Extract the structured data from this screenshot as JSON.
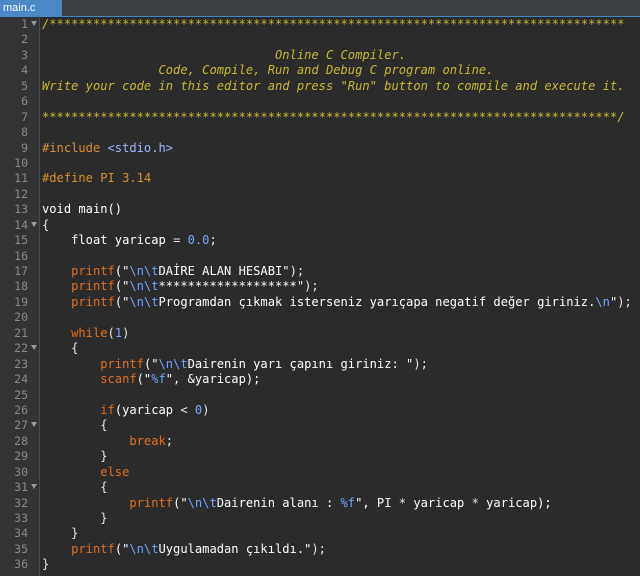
{
  "tab": {
    "label": "main.c"
  },
  "lines": [
    {
      "n": "1",
      "fold": true,
      "t": [
        [
          "/*******************************************************************************",
          "com"
        ]
      ]
    },
    {
      "n": "2",
      "fold": false,
      "t": []
    },
    {
      "n": "3",
      "fold": false,
      "t": [
        [
          "                                Online C Compiler.",
          "com"
        ]
      ]
    },
    {
      "n": "4",
      "fold": false,
      "t": [
        [
          "                Code, Compile, Run and Debug C program online.",
          "com"
        ]
      ]
    },
    {
      "n": "5",
      "fold": false,
      "t": [
        [
          "Write your code in this editor and press \"Run\" button to compile and execute it.",
          "com"
        ]
      ]
    },
    {
      "n": "6",
      "fold": false,
      "t": []
    },
    {
      "n": "7",
      "fold": false,
      "t": [
        [
          "*******************************************************************************/",
          "com"
        ]
      ]
    },
    {
      "n": "8",
      "fold": false,
      "t": []
    },
    {
      "n": "9",
      "fold": false,
      "t": [
        [
          "#include ",
          "pp"
        ],
        [
          "<stdio.h>",
          "inc"
        ]
      ]
    },
    {
      "n": "10",
      "fold": false,
      "t": []
    },
    {
      "n": "11",
      "fold": false,
      "t": [
        [
          "#define PI 3.14",
          "pp"
        ]
      ]
    },
    {
      "n": "12",
      "fold": false,
      "t": []
    },
    {
      "n": "13",
      "fold": false,
      "t": [
        [
          "void main()",
          "kw"
        ]
      ]
    },
    {
      "n": "14",
      "fold": true,
      "t": [
        [
          "{",
          "op"
        ]
      ]
    },
    {
      "n": "15",
      "fold": false,
      "t": [
        [
          "    float yaricap ",
          "kw"
        ],
        [
          "= ",
          "op"
        ],
        [
          "0.0",
          "num"
        ],
        [
          ";",
          "op"
        ]
      ]
    },
    {
      "n": "16",
      "fold": false,
      "t": []
    },
    {
      "n": "17",
      "fold": false,
      "t": [
        [
          "    printf",
          "fn"
        ],
        [
          "(\"",
          "str"
        ],
        [
          "\\n\\t",
          "esc"
        ],
        [
          "DAİRE ALAN HESABI\"",
          "str"
        ],
        [
          ");",
          "op"
        ]
      ]
    },
    {
      "n": "18",
      "fold": false,
      "t": [
        [
          "    printf",
          "fn"
        ],
        [
          "(\"",
          "str"
        ],
        [
          "\\n\\t",
          "esc"
        ],
        [
          "*******************\"",
          "str"
        ],
        [
          ");",
          "op"
        ]
      ]
    },
    {
      "n": "19",
      "fold": false,
      "t": [
        [
          "    printf",
          "fn"
        ],
        [
          "(\"",
          "str"
        ],
        [
          "\\n\\t",
          "esc"
        ],
        [
          "Programdan çıkmak isterseniz yarıçapa negatif değer giriniz.",
          "str"
        ],
        [
          "\\n",
          "esc"
        ],
        [
          "\"",
          "str"
        ],
        [
          ");",
          "op"
        ]
      ]
    },
    {
      "n": "20",
      "fold": false,
      "t": []
    },
    {
      "n": "21",
      "fold": false,
      "t": [
        [
          "    while",
          "fn"
        ],
        [
          "(",
          "op"
        ],
        [
          "1",
          "num"
        ],
        [
          ")",
          "op"
        ]
      ]
    },
    {
      "n": "22",
      "fold": true,
      "t": [
        [
          "    {",
          "op"
        ]
      ]
    },
    {
      "n": "23",
      "fold": false,
      "t": [
        [
          "        printf",
          "fn"
        ],
        [
          "(\"",
          "str"
        ],
        [
          "\\n\\t",
          "esc"
        ],
        [
          "Dairenin yarı çapını giriniz: \"",
          "str"
        ],
        [
          ");",
          "op"
        ]
      ]
    },
    {
      "n": "24",
      "fold": false,
      "t": [
        [
          "        scanf",
          "fn"
        ],
        [
          "(\"",
          "str"
        ],
        [
          "%f",
          "esc"
        ],
        [
          "\", &yaricap);",
          "str"
        ]
      ]
    },
    {
      "n": "25",
      "fold": false,
      "t": []
    },
    {
      "n": "26",
      "fold": false,
      "t": [
        [
          "        if",
          "fn"
        ],
        [
          "(yaricap ",
          "kw"
        ],
        [
          "< ",
          "op"
        ],
        [
          "0",
          "num"
        ],
        [
          ")",
          "op"
        ]
      ]
    },
    {
      "n": "27",
      "fold": true,
      "t": [
        [
          "        {",
          "op"
        ]
      ]
    },
    {
      "n": "28",
      "fold": false,
      "t": [
        [
          "            break",
          "brk"
        ],
        [
          ";",
          "op"
        ]
      ]
    },
    {
      "n": "29",
      "fold": false,
      "t": [
        [
          "        }",
          "op"
        ]
      ]
    },
    {
      "n": "30",
      "fold": false,
      "t": [
        [
          "        else",
          "brk"
        ]
      ]
    },
    {
      "n": "31",
      "fold": true,
      "t": [
        [
          "        {",
          "op"
        ]
      ]
    },
    {
      "n": "32",
      "fold": false,
      "t": [
        [
          "            printf",
          "fn"
        ],
        [
          "(\"",
          "str"
        ],
        [
          "\\n\\t",
          "esc"
        ],
        [
          "Dairenin alanı : ",
          "str"
        ],
        [
          "%f",
          "esc"
        ],
        [
          "\", PI ",
          "str"
        ],
        [
          "* ",
          "op"
        ],
        [
          "yaricap ",
          "kw"
        ],
        [
          "* ",
          "op"
        ],
        [
          "yaricap);",
          "kw"
        ]
      ]
    },
    {
      "n": "33",
      "fold": false,
      "t": [
        [
          "        }",
          "op"
        ]
      ]
    },
    {
      "n": "34",
      "fold": false,
      "t": [
        [
          "    }",
          "op"
        ]
      ]
    },
    {
      "n": "35",
      "fold": false,
      "t": [
        [
          "    printf",
          "fn"
        ],
        [
          "(\"",
          "str"
        ],
        [
          "\\n\\t",
          "esc"
        ],
        [
          "Uygulamadan çıkıldı.\"",
          "str"
        ],
        [
          ");",
          "op"
        ]
      ]
    },
    {
      "n": "36",
      "fold": false,
      "t": [
        [
          "}",
          "op"
        ]
      ]
    }
  ]
}
